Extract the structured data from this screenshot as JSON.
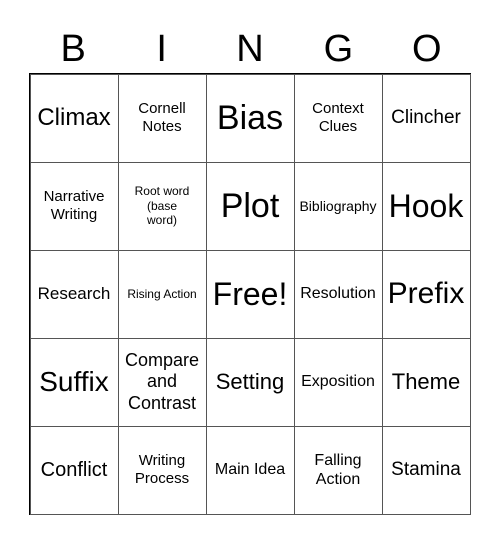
{
  "header": [
    "B",
    "I",
    "N",
    "G",
    "O"
  ],
  "cells": [
    [
      "Climax",
      "Cornell Notes",
      "Bias",
      "Context Clues",
      "Clincher"
    ],
    [
      "Narrative Writing",
      "Root word (base word)",
      "Plot",
      "Bibliography",
      "Hook"
    ],
    [
      "Research",
      "Rising Action",
      "Free!",
      "Resolution",
      "Prefix"
    ],
    [
      "Suffix",
      "Compare and Contrast",
      "Setting",
      "Exposition",
      "Theme"
    ],
    [
      "Conflict",
      "Writing Process",
      "Main Idea",
      "Falling Action",
      "Stamina"
    ]
  ]
}
